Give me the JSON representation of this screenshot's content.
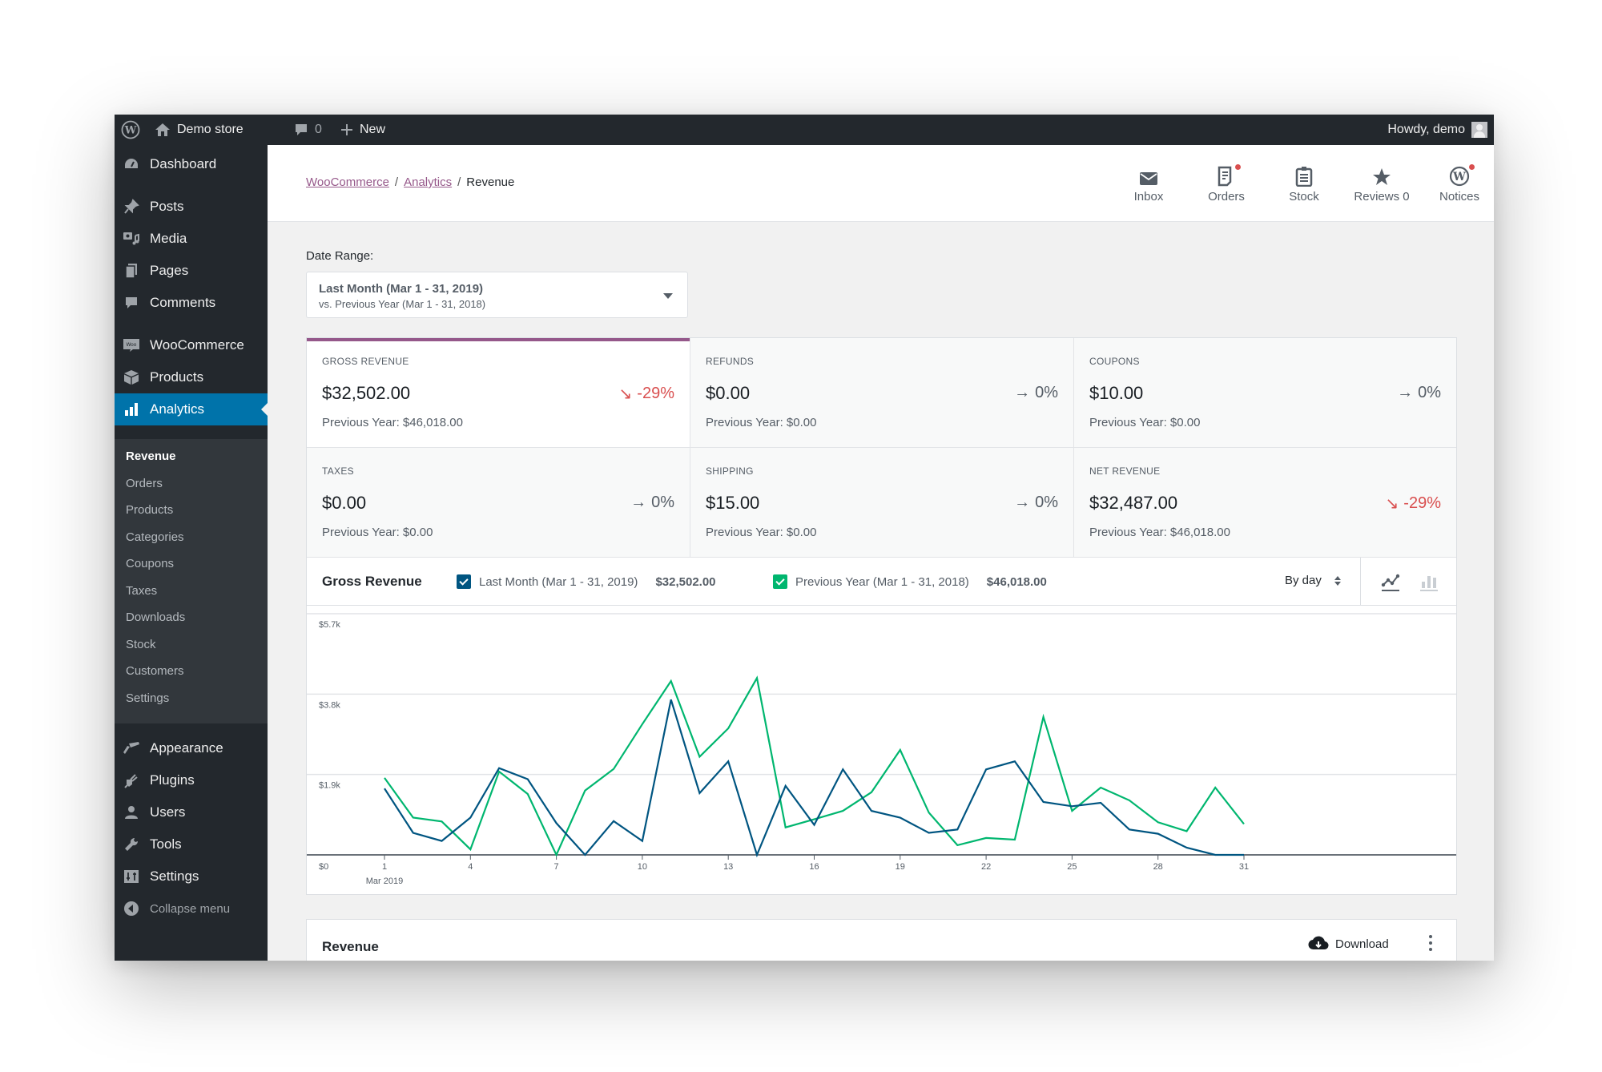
{
  "admin_bar": {
    "site_name": "Demo store",
    "comments_count": "0",
    "new_label": "New",
    "howdy": "Howdy, demo"
  },
  "sidebar": {
    "items": [
      {
        "label": "Dashboard",
        "icon": "dashboard-icon"
      },
      {
        "label": "Posts",
        "icon": "pin-icon"
      },
      {
        "label": "Media",
        "icon": "media-icon"
      },
      {
        "label": "Pages",
        "icon": "pages-icon"
      },
      {
        "label": "Comments",
        "icon": "comment-icon"
      },
      {
        "label": "WooCommerce",
        "icon": "woo-icon"
      },
      {
        "label": "Products",
        "icon": "box-icon"
      },
      {
        "label": "Analytics",
        "icon": "bar-chart-icon",
        "active": true
      },
      {
        "label": "Appearance",
        "icon": "brush-icon"
      },
      {
        "label": "Plugins",
        "icon": "plug-icon"
      },
      {
        "label": "Users",
        "icon": "user-icon"
      },
      {
        "label": "Tools",
        "icon": "wrench-icon"
      },
      {
        "label": "Settings",
        "icon": "sliders-icon"
      }
    ],
    "analytics_submenu": [
      "Revenue",
      "Orders",
      "Products",
      "Categories",
      "Coupons",
      "Taxes",
      "Downloads",
      "Stock",
      "Customers",
      "Settings"
    ],
    "current_submenu": "Revenue",
    "collapse_label": "Collapse menu"
  },
  "header": {
    "breadcrumb": [
      {
        "label": "WooCommerce",
        "link": true
      },
      {
        "label": "Analytics",
        "link": true
      },
      {
        "label": "Revenue",
        "link": false
      }
    ],
    "activity": [
      {
        "label": "Inbox",
        "icon": "envelope-icon",
        "unread": false
      },
      {
        "label": "Orders",
        "icon": "document-icon",
        "unread": true
      },
      {
        "label": "Stock",
        "icon": "clipboard-icon",
        "unread": false
      },
      {
        "label": "Reviews 0",
        "icon": "star-icon",
        "unread": false
      },
      {
        "label": "Notices",
        "icon": "wordpress-icon",
        "unread": true
      }
    ]
  },
  "filters": {
    "date_range_label": "Date Range:",
    "date_range_primary": "Last Month (Mar 1 - 31, 2019)",
    "date_range_secondary": "vs. Previous Year (Mar 1 - 31, 2018)"
  },
  "summary": [
    {
      "label": "GROSS REVENUE",
      "value": "$32,502.00",
      "delta": "-29%",
      "direction": "down",
      "previous": "Previous Year: $46,018.00",
      "selected": true
    },
    {
      "label": "REFUNDS",
      "value": "$0.00",
      "delta": "0%",
      "direction": "flat",
      "previous": "Previous Year: $0.00"
    },
    {
      "label": "COUPONS",
      "value": "$10.00",
      "delta": "0%",
      "direction": "flat",
      "previous": "Previous Year: $0.00"
    },
    {
      "label": "TAXES",
      "value": "$0.00",
      "delta": "0%",
      "direction": "flat",
      "previous": "Previous Year: $0.00"
    },
    {
      "label": "SHIPPING",
      "value": "$15.00",
      "delta": "0%",
      "direction": "flat",
      "previous": "Previous Year: $0.00"
    },
    {
      "label": "NET REVENUE",
      "value": "$32,487.00",
      "delta": "-29%",
      "direction": "down",
      "previous": "Previous Year: $46,018.00"
    }
  ],
  "chart_panel": {
    "title": "Gross Revenue",
    "legend": [
      {
        "label": "Last Month (Mar 1 - 31, 2019)",
        "total": "$32,502.00",
        "color": "#005581",
        "checked": true
      },
      {
        "label": "Previous Year (Mar 1 - 31, 2018)",
        "total": "$46,018.00",
        "color": "#00b66f",
        "checked": true
      }
    ],
    "interval": "By day",
    "chart_types": [
      {
        "name": "line",
        "active": true
      },
      {
        "name": "bar",
        "active": false
      }
    ]
  },
  "chart_data": {
    "type": "line",
    "title": "Gross Revenue",
    "xlabel": "Mar 2019",
    "ylabel": "",
    "x": [
      1,
      2,
      3,
      4,
      5,
      6,
      7,
      8,
      9,
      10,
      11,
      12,
      13,
      14,
      15,
      16,
      17,
      18,
      19,
      20,
      21,
      22,
      23,
      24,
      25,
      26,
      27,
      28,
      29,
      30,
      31
    ],
    "x_ticks": [
      "1",
      "4",
      "7",
      "10",
      "13",
      "16",
      "19",
      "22",
      "25",
      "28",
      "31"
    ],
    "y_ticks": [
      "$0",
      "$1.9k",
      "$3.8k",
      "$5.7k"
    ],
    "y_tick_values": [
      0,
      1900,
      3800,
      5700
    ],
    "ylim": [
      0,
      5700
    ],
    "grid": true,
    "legend_position": "top",
    "series": [
      {
        "name": "Last Month (Mar 1 - 31, 2019)",
        "color": "#005581",
        "values": [
          1570,
          520,
          330,
          880,
          2050,
          1790,
          750,
          0,
          800,
          330,
          3670,
          1460,
          2210,
          0,
          1630,
          710,
          2020,
          1040,
          880,
          520,
          600,
          2020,
          2210,
          1250,
          1150,
          1230,
          600,
          500,
          170,
          0,
          0
        ]
      },
      {
        "name": "Previous Year (Mar 1 - 31, 2018)",
        "color": "#00b66f",
        "values": [
          1820,
          880,
          790,
          130,
          1970,
          1440,
          0,
          1520,
          2030,
          3090,
          4110,
          2320,
          2990,
          4180,
          650,
          840,
          1040,
          1480,
          2480,
          1000,
          230,
          400,
          360,
          3260,
          1040,
          1590,
          1290,
          770,
          560,
          1590,
          730
        ]
      }
    ]
  },
  "revenue_table": {
    "title": "Revenue",
    "download_label": "Download"
  }
}
